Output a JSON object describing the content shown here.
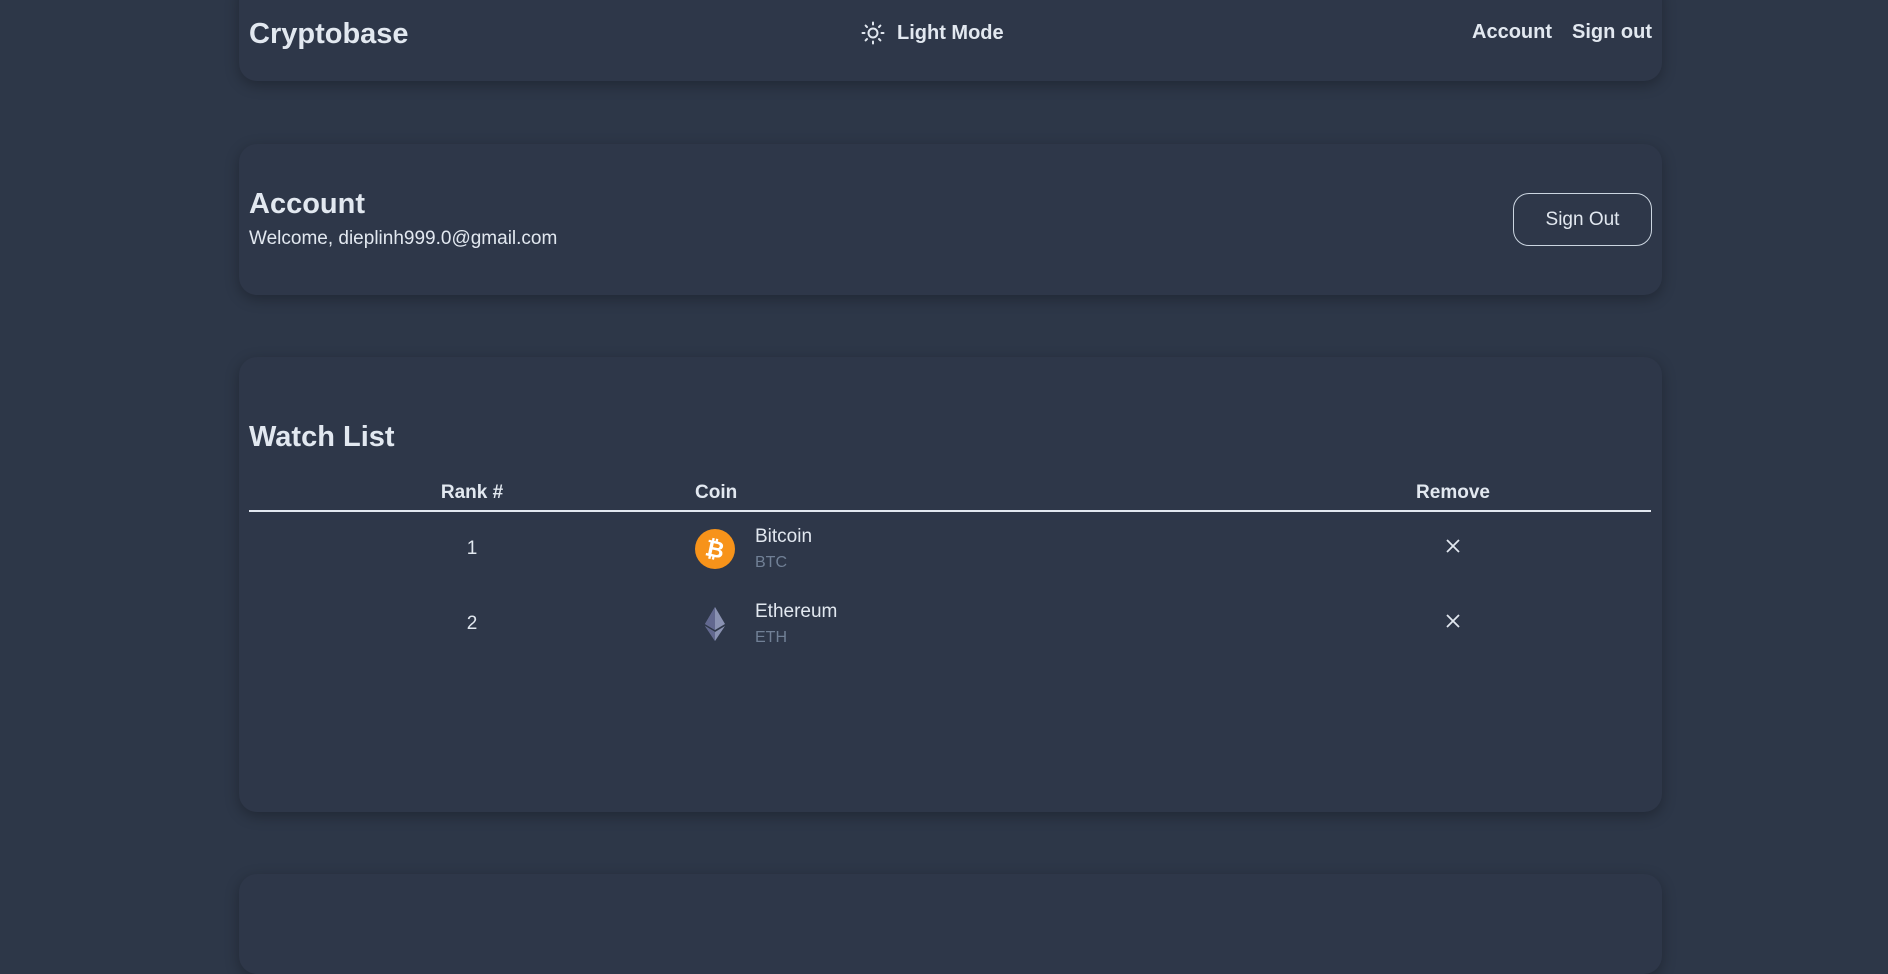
{
  "navbar": {
    "brand": "Cryptobase",
    "theme_toggle_label": "Light Mode",
    "theme_icon": "sun-icon",
    "links": [
      "Account",
      "Sign out"
    ]
  },
  "account": {
    "title": "Account",
    "welcome": "Welcome, dieplinh999.0@gmail.com",
    "signout_label": "Sign Out"
  },
  "watchlist": {
    "title": "Watch List",
    "headers": [
      "Rank #",
      "Coin",
      "Remove"
    ],
    "rows": [
      {
        "rank": "1",
        "name": "Bitcoin",
        "symbol": "BTC",
        "icon": "bitcoin-icon",
        "color": "#f7931a"
      },
      {
        "rank": "2",
        "name": "Ethereum",
        "symbol": "ETH",
        "icon": "ethereum-icon",
        "color": "#8a92b2"
      }
    ]
  },
  "colors": {
    "background": "#2d3748",
    "card": "#2e3749",
    "text": "#e2e8f0",
    "muted": "#718096"
  }
}
